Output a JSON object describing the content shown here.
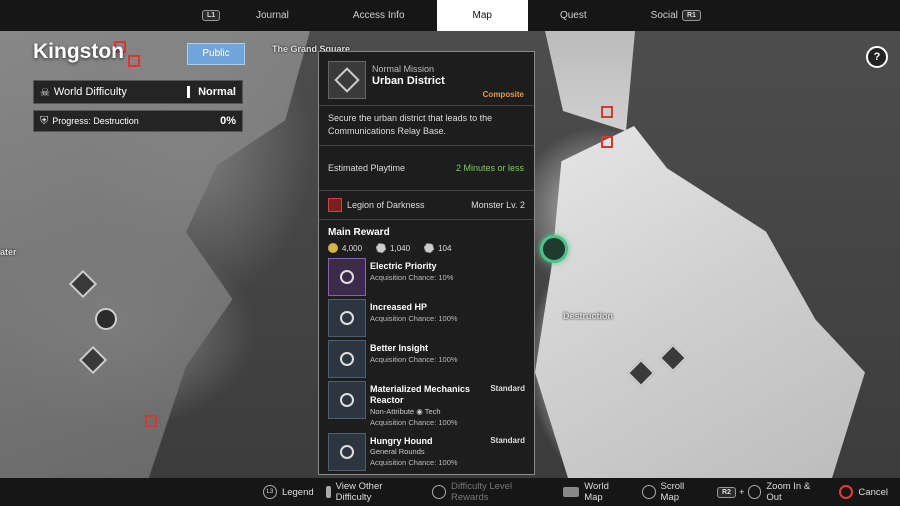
{
  "nav": {
    "left_cap": "L1",
    "right_cap": "R1",
    "tabs": [
      "Journal",
      "Access Info",
      "Map",
      "Quest",
      "Social"
    ],
    "active_tab": "Map"
  },
  "region": {
    "name": "Kingston",
    "visibility_button": "Public",
    "difficulty_label": "World Difficulty",
    "difficulty_value": "Normal",
    "progress_label": "Progress: Destruction",
    "progress_value": "0%"
  },
  "map_labels": {
    "grand_square": "The Grand Square",
    "water": "ater",
    "destruction": "Destruction"
  },
  "help": "?",
  "mission": {
    "type": "Normal Mission",
    "name": "Urban District",
    "tag": "Composite",
    "description": "Secure the urban district that leads to the Communications Relay Base.",
    "playtime_label": "Estimated Playtime",
    "playtime_value": "2 Minutes or less",
    "enemy": "Legion of Darkness",
    "monster_level": "Monster Lv. 2",
    "reward_heading": "Main Reward",
    "currencies": [
      "4,000",
      "1,040",
      "104"
    ],
    "rewards": [
      {
        "name": "Electric Priority",
        "chance": "Acquisition Chance: 10%",
        "standard": "",
        "sub": ""
      },
      {
        "name": "Increased HP",
        "chance": "Acquisition Chance: 100%",
        "standard": "",
        "sub": ""
      },
      {
        "name": "Better Insight",
        "chance": "Acquisition Chance: 100%",
        "standard": "",
        "sub": ""
      },
      {
        "name": "Materialized Mechanics Reactor",
        "chance": "Acquisition Chance: 100%",
        "standard": "Standard",
        "sub": "Non-Attribute  ◉ Tech"
      },
      {
        "name": "Hungry Hound",
        "chance": "Acquisition Chance: 100%",
        "standard": "Standard",
        "sub": "General Rounds"
      }
    ]
  },
  "bottom": {
    "legend": "Legend",
    "view_other": "View Other Difficulty",
    "difficulty_rewards": "Difficulty Level Rewards",
    "world_map": "World Map",
    "scroll_map": "Scroll Map",
    "zoom": "Zoom In & Out",
    "cancel": "Cancel",
    "zoom_caps": "R2",
    "legend_cap": "L3"
  }
}
